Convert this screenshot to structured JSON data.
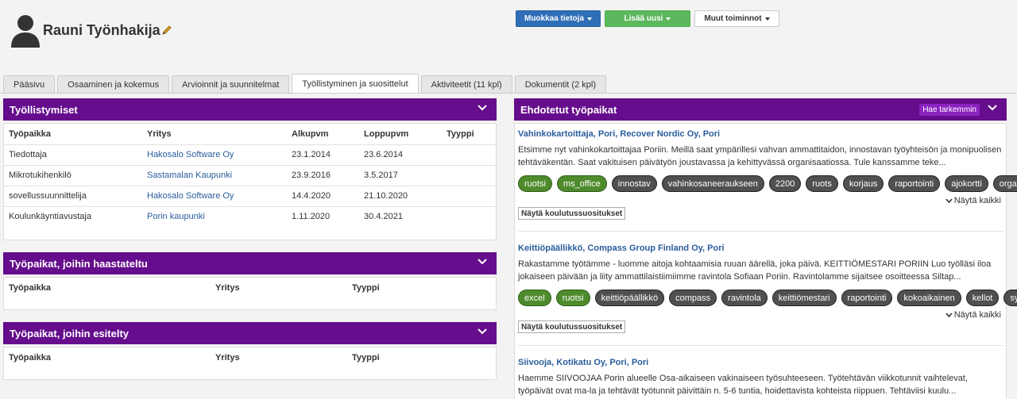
{
  "header": {
    "name": "Rauni Työnhakija",
    "buttons": {
      "edit": "Muokkaa tietoja",
      "add": "Lisää uusi",
      "other": "Muut toiminnot"
    }
  },
  "tabs": [
    "Pääsivu",
    "Osaaminen ja kokemus",
    "Arvioinnit ja suunnitelmat",
    "Työllistyminen ja suosittelut",
    "Aktiviteetit (11 kpl)",
    "Dokumentit (2 kpl)"
  ],
  "employments": {
    "title": "Työllistymiset",
    "columns": [
      "Työpaikka",
      "Yritys",
      "Alkupvm",
      "Loppupvm",
      "Tyyppi"
    ],
    "rows": [
      [
        "Tiedottaja",
        "Hakosalo Software Oy",
        "23.1.2014",
        "23.6.2014",
        ""
      ],
      [
        "Mikrotukihenkilö",
        "Sastamalan Kaupunki",
        "23.9.2016",
        "3.5.2017",
        ""
      ],
      [
        "sovellussuunnittelija",
        "Hakosalo Software Oy",
        "14.4.2020",
        "21.10.2020",
        ""
      ],
      [
        "Koulunkäyntiavustaja",
        "Porin kaupunki",
        "1.11.2020",
        "30.4.2021",
        ""
      ]
    ]
  },
  "interviewed": {
    "title": "Työpaikat, joihin haastateltu",
    "columns": [
      "Työpaikka",
      "Yritys",
      "Tyyppi"
    ]
  },
  "presented": {
    "title": "Työpaikat, joihin esitelty",
    "columns": [
      "Työpaikka",
      "Yritys",
      "Tyyppi"
    ]
  },
  "suggested": {
    "title": "Ehdotetut työpaikat",
    "search_more": "Hae tarkemmin",
    "show_all": "Näytä kaikki",
    "show_training": "Näytä koulutussuositukset",
    "jobs": [
      {
        "title": "Vahinkokartoittaja, Pori, Recover Nordic Oy, Pori",
        "desc": "Etsimme nyt vahinkokartoittajaa Poriin. Meillä saat ympärillesi vahvan ammattitaidon, innostavan työyhteisön ja monipuolisen tehtäväkentän. Saat vakituisen päivätyön joustavassa ja kehittyvässä organisaatiossa. Tule kanssamme teke...",
        "tags_green": [
          "ruotsi",
          "ms_office"
        ],
        "tags": [
          "innostav",
          "vahinkosaneeraukseen",
          "2200",
          "ruots",
          "korjaus",
          "raportointi",
          "ajokortti",
          "organisoinni"
        ]
      },
      {
        "title": "Keittiöpäällikkö, Compass Group Finland Oy, Pori",
        "desc": "Rakastamme työtämme - luomme aitoja kohtaamisia ruuan äärellä, joka päivä. KEITTIÖMESTARI PORIIN Luo työlläsi iloa jokaiseen päivään ja liity ammattilaistiimiimme ravintola Sofiaan Poriin. Ravintolamme sijaitsee osoitteessa Siltap...",
        "tags_green": [
          "excel",
          "ruotsi"
        ],
        "tags": [
          "keittiöpäällikkö",
          "compass",
          "ravintola",
          "keittiömestari",
          "raportointi",
          "kokoaikainen",
          "kellot",
          "sydän"
        ]
      },
      {
        "title": "Siivooja, Kotikatu Oy, Pori, Pori",
        "desc": "Haemme SIIVOOJAA Porin alueelle Osa-aikaiseen vakinaiseen työsuhteeseen. Työtehtävän viikkotunnit vaihtelevat, työpäivät ovat ma-la ja tehtävät työtunnit päivittäin n. 5-6 tuntia, hoidettavista kohteista riippuen. Tehtäviisi kuulu..."
      }
    ]
  }
}
